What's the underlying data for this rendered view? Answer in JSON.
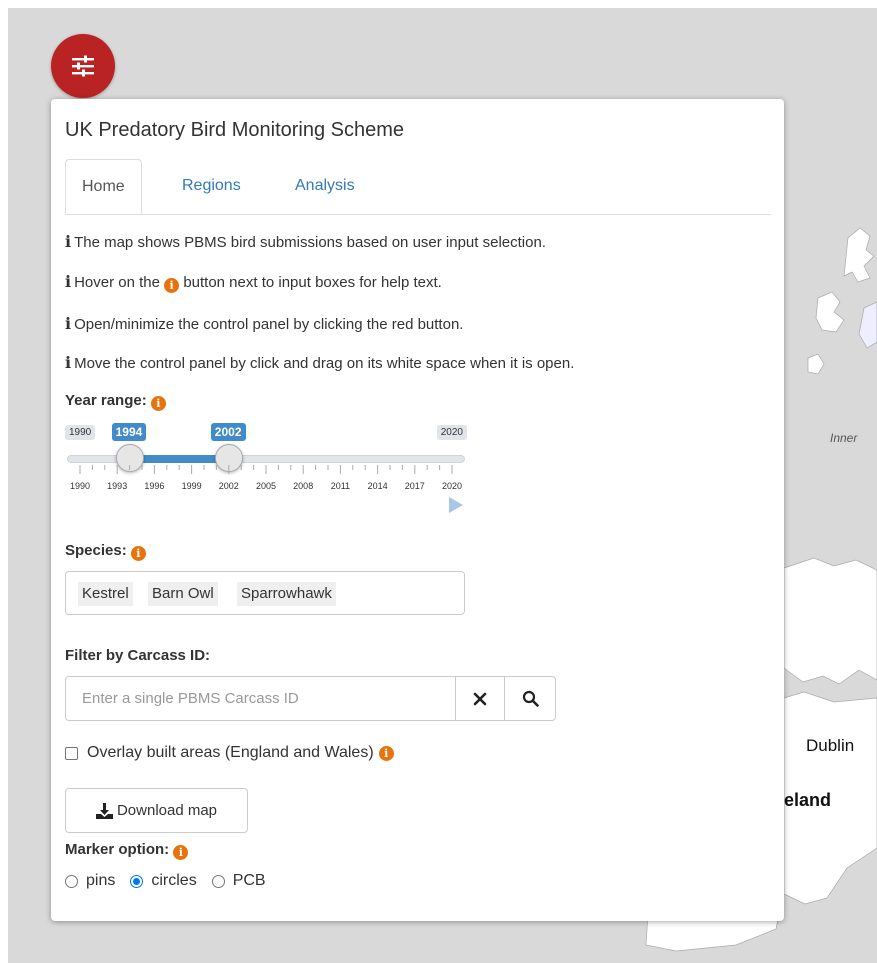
{
  "panel": {
    "title": "UK Predatory Bird Monitoring Scheme"
  },
  "tabs": [
    {
      "label": "Home",
      "active": true
    },
    {
      "label": "Regions",
      "active": false
    },
    {
      "label": "Analysis",
      "active": false
    }
  ],
  "info": {
    "line1": "The map shows PBMS bird submissions based on user input selection.",
    "line2_pre": "Hover on the",
    "line2_post": "button next to input boxes for help text.",
    "line3": "Open/minimize the control panel by clicking the red button.",
    "line4": "Move the control panel by click and drag on its white space when it is open."
  },
  "year_range": {
    "label": "Year range:",
    "min": 1990,
    "max": 2020,
    "selected_from": 1994,
    "selected_to": 2002,
    "min_label": "1990",
    "max_label": "2020",
    "from_label": "1994",
    "to_label": "2002",
    "tick_labels": [
      "1990",
      "1993",
      "1996",
      "1999",
      "2002",
      "2005",
      "2008",
      "2011",
      "2014",
      "2017",
      "2020"
    ]
  },
  "species": {
    "label": "Species:",
    "selected": [
      "Kestrel",
      "Barn Owl",
      "Sparrowhawk"
    ]
  },
  "carcass": {
    "label": "Filter by Carcass ID:",
    "placeholder": "Enter a single PBMS Carcass ID",
    "value": ""
  },
  "overlay": {
    "label": "Overlay built areas (England and Wales)",
    "checked": false
  },
  "download": {
    "label": "Download map"
  },
  "marker": {
    "label": "Marker option:",
    "options": [
      "pins",
      "circles",
      "PCB"
    ],
    "selected": "circles"
  },
  "map": {
    "labels": {
      "dublin": "Dublin",
      "ireland": "eland",
      "inner": "Inner"
    }
  },
  "colors": {
    "toggle_button": "#b92323",
    "slider_accent": "#428bca",
    "info_icon": "#e8730d"
  },
  "icons": {
    "toggle": "sliders-icon",
    "info": "info-icon",
    "help": "orange-info-icon",
    "clear": "close-icon",
    "search": "search-icon",
    "download": "download-icon",
    "play": "play-icon"
  }
}
